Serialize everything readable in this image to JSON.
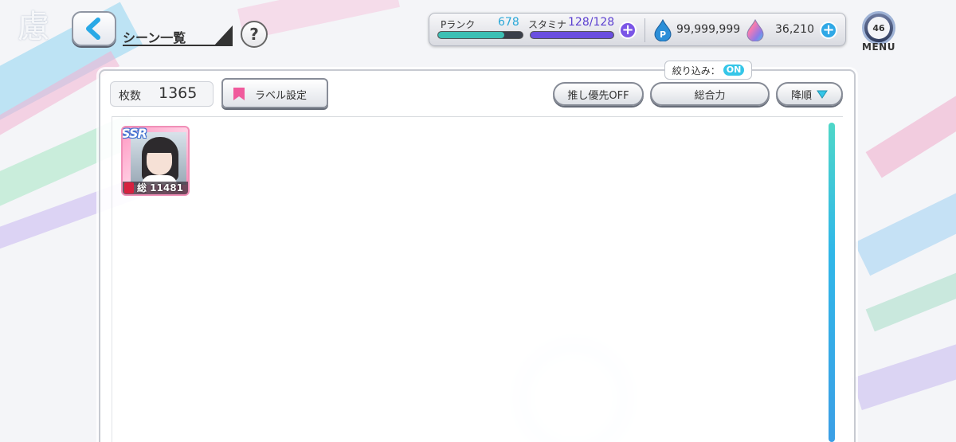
{
  "header": {
    "title": "シーン一覧",
    "help_label": "?",
    "menu": {
      "label": "MENU",
      "badge": "46"
    }
  },
  "status": {
    "rank_label": "Pランク",
    "rank_value": "678",
    "rank_progress": 0.78,
    "stamina_label": "スタミナ",
    "stamina_value": "128/128",
    "stamina_progress": 1.0,
    "paid_currency": "99,999,999",
    "free_currency": "36,210",
    "plus_label": "+"
  },
  "toolbar": {
    "count_label": "枚数",
    "count_value": "1365",
    "label_settings": "ラベル設定",
    "oshi_priority": "推し優先OFF",
    "filter_prefix": "絞り込み：",
    "filter_state": "ON",
    "sort_key": "総合力",
    "sort_order": "降順"
  },
  "cards": [
    {
      "rarity": "SSR",
      "power": "総 11481"
    }
  ],
  "background": {
    "kanji": "慮"
  },
  "colors": {
    "rank_fill": "#3cc0b4",
    "stamina_fill": "#6a4fe0",
    "accent_cyan": "#35c6e8",
    "card_frame": "#f08fb7",
    "plus_stamina": "#7a55e6",
    "plus_currency": "#2fa8e6"
  }
}
